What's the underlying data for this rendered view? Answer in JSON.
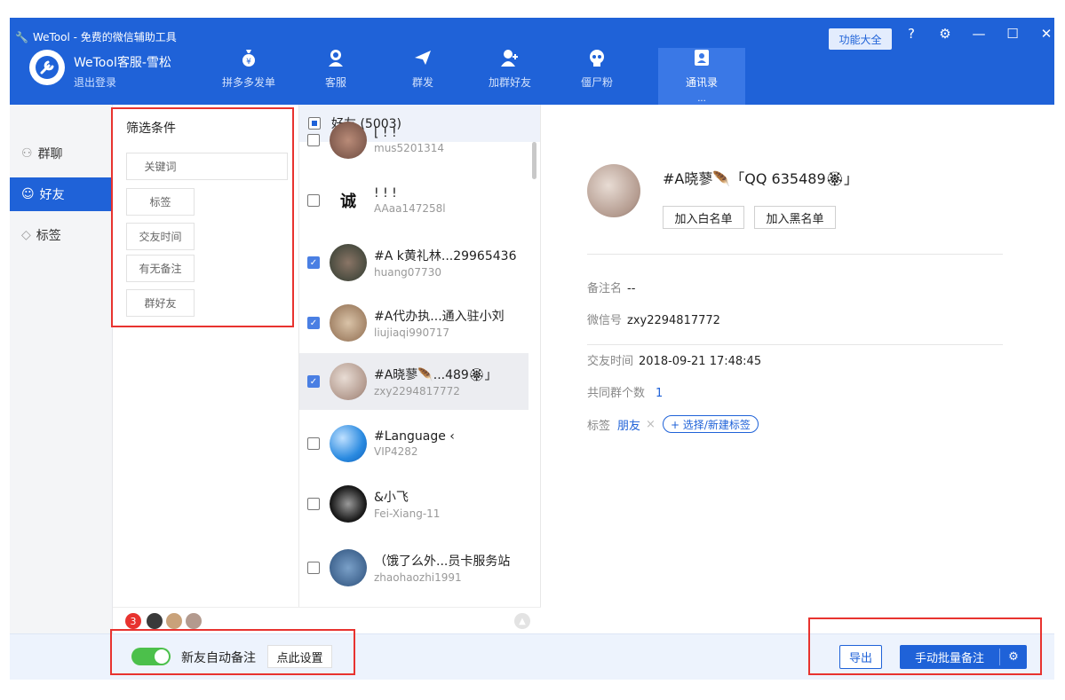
{
  "app": {
    "title": "WeTool - 免费的微信辅助工具",
    "user_name": "WeTool客服-雪松",
    "logout": "退出登录",
    "all_features": "功能大全"
  },
  "tabs": [
    {
      "label": "拼多多发单",
      "icon": "moneybag-icon"
    },
    {
      "label": "客服",
      "icon": "headset-icon"
    },
    {
      "label": "群发",
      "icon": "send-icon"
    },
    {
      "label": "加群好友",
      "icon": "add-user-icon"
    },
    {
      "label": "僵尸粉",
      "icon": "skull-icon"
    },
    {
      "label": "通讯录",
      "icon": "contacts-icon",
      "active": true,
      "more": "..."
    }
  ],
  "nav": [
    {
      "label": "群聊",
      "icon": "group-icon"
    },
    {
      "label": "好友",
      "icon": "user-icon",
      "active": true
    },
    {
      "label": "标签",
      "icon": "tag-icon"
    }
  ],
  "filter": {
    "title": "筛选条件",
    "buttons": [
      "关键词",
      "标签",
      "交友时间",
      "有无备注",
      "群好友"
    ]
  },
  "list": {
    "header": "好友 (5003)",
    "rows": [
      {
        "name": "[ ! !",
        "id": "mus5201314",
        "checked": false
      },
      {
        "name": "! ! !",
        "id": "AAaa147258l",
        "checked": false
      },
      {
        "name": "#A  k黄礼林...29965436",
        "id": "huang07730",
        "checked": true
      },
      {
        "name": "#A代办执...通入驻小刘",
        "id": "liujiaqi990717",
        "checked": true
      },
      {
        "name": "#A晓蓼🪶...489🏵」",
        "id": "zxy2294817772",
        "checked": true,
        "selected": true
      },
      {
        "name": "#Language ‹",
        "id": "VIP4282",
        "checked": false
      },
      {
        "name": "&小飞",
        "id": "Fei-Xiang-11",
        "checked": false
      },
      {
        "name": "（饿了么外...员卡服务站",
        "id": "zhaohaozhi1991",
        "checked": false
      }
    ]
  },
  "bottom_strip": {
    "badge": "3"
  },
  "detail": {
    "name": "#A晓蓼🪶「QQ 635489🏵」",
    "whitelist": "加入白名单",
    "blacklist": "加入黑名单",
    "remark_label": "备注名",
    "remark_value": "--",
    "wechat_label": "微信号",
    "wechat_value": "zxy2294817772",
    "time_label": "交友时间",
    "time_value": "2018-09-21 17:48:45",
    "groups_label": "共同群个数",
    "groups_value": "1",
    "tag_label": "标签",
    "tag_value": "朋友",
    "tag_remove": "×",
    "tag_add": "+ 选择/新建标签"
  },
  "footer": {
    "auto_remark": "新友自动备注",
    "settings": "点此设置",
    "export": "导出",
    "batch": "手动批量备注"
  },
  "colors": {
    "primary": "#1f62d8",
    "toggle": "#4cc04b",
    "highlight": "#e8332f"
  }
}
